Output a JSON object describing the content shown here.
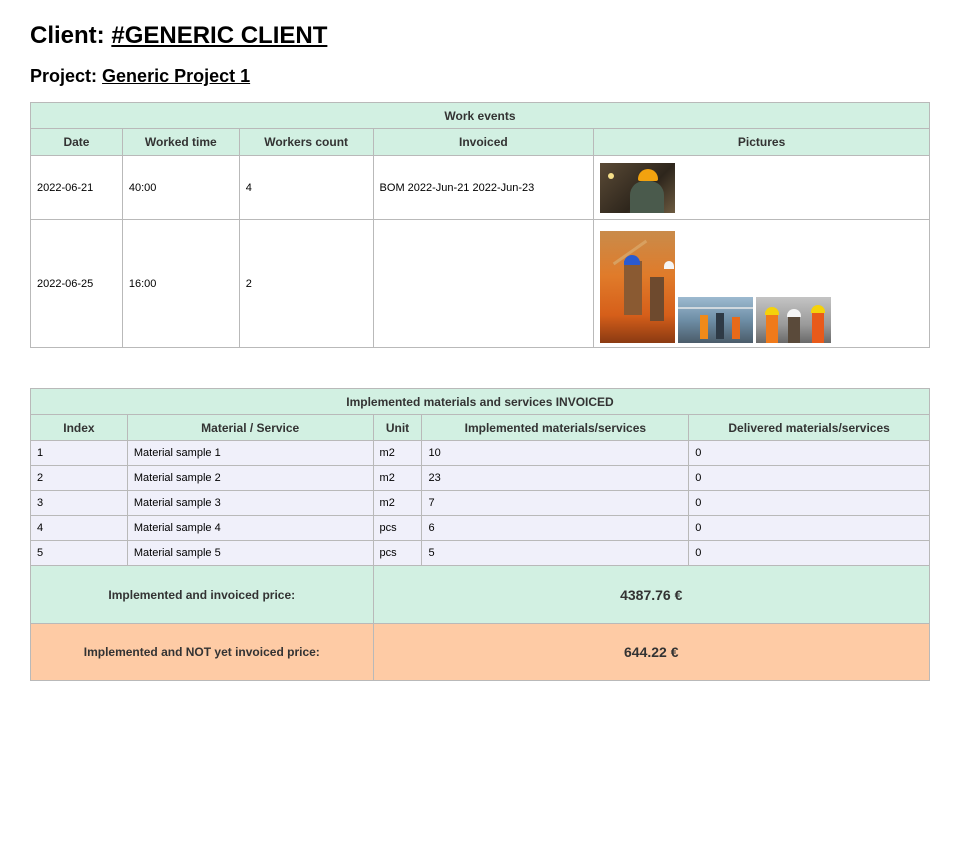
{
  "header": {
    "client_label": "Client:",
    "client_name": "#GENERIC CLIENT",
    "project_label": "Project:",
    "project_name": "Generic Project 1"
  },
  "work_events": {
    "title": "Work events",
    "columns": [
      "Date",
      "Worked time",
      "Workers count",
      "Invoiced",
      "Pictures"
    ],
    "rows": [
      {
        "date": "2022-06-21",
        "worked_time": "40:00",
        "workers": "4",
        "invoiced": "BOM 2022-Jun-21 2022-Jun-23",
        "pictures": [
          "worker-helmet-photo"
        ]
      },
      {
        "date": "2022-06-25",
        "worked_time": "16:00",
        "workers": "2",
        "invoiced": "",
        "pictures": [
          "construction-worker-photo",
          "site-team-photo",
          "workers-group-photo"
        ]
      }
    ]
  },
  "materials": {
    "title": "Implemented materials and services INVOICED",
    "columns": [
      "Index",
      "Material / Service",
      "Unit",
      "Implemented materials/services",
      "Delivered materials/services"
    ],
    "rows": [
      {
        "index": "1",
        "name": "Material sample 1",
        "unit": "m2",
        "implemented": "10",
        "delivered": "0"
      },
      {
        "index": "2",
        "name": "Material sample 2",
        "unit": "m2",
        "implemented": "23",
        "delivered": "0"
      },
      {
        "index": "3",
        "name": "Material sample 3",
        "unit": "m2",
        "implemented": "7",
        "delivered": "0"
      },
      {
        "index": "4",
        "name": "Material sample 4",
        "unit": "pcs",
        "implemented": "6",
        "delivered": "0"
      },
      {
        "index": "5",
        "name": "Material sample 5",
        "unit": "pcs",
        "implemented": "5",
        "delivered": "0"
      }
    ],
    "invoiced_label": "Implemented and invoiced price:",
    "invoiced_value": "4387.76 €",
    "not_invoiced_label": "Implemented and NOT yet invoiced price:",
    "not_invoiced_value": "644.22 €"
  },
  "colors": {
    "header_bg": "#d2f0e2",
    "row_bg": "#f0f0fa",
    "not_invoiced_bg": "#fecba5"
  }
}
